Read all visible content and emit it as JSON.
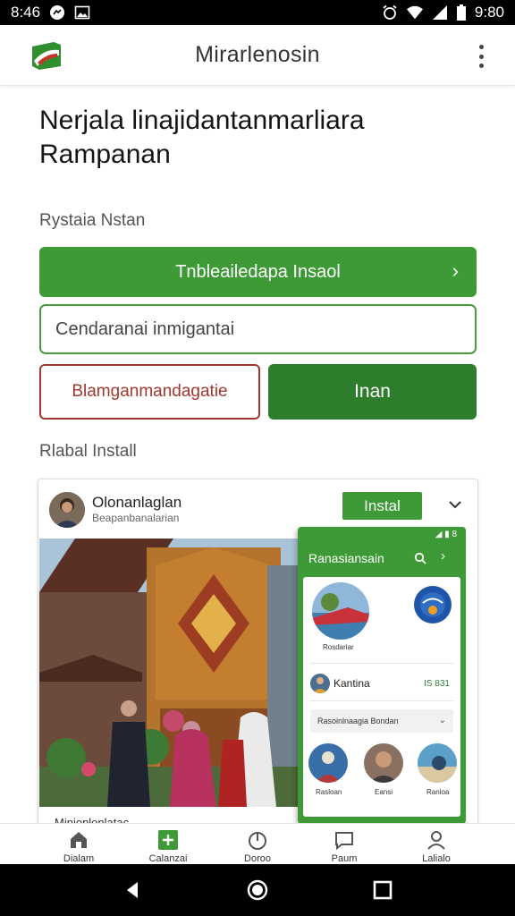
{
  "status_bar": {
    "time_left": "8:46",
    "time_right": "9:80"
  },
  "app": {
    "title": "Mirarlenosin"
  },
  "headline": {
    "line1": "Nerjala linajidantanmarliara",
    "line2": "Rampanan"
  },
  "section_install": {
    "label": "Rystaia Nstan",
    "primary_button": "Tnbleailedapa Insaol",
    "input_placeholder": "Cendaranai inmigantai",
    "outline_button": "Blamganmandagatie",
    "solid_button": "Inan"
  },
  "section_mabal": {
    "label": "Rlabal Install"
  },
  "card": {
    "author": "Olonanlaglan",
    "subtitle": "Beapanbanalarian",
    "install_label": "Instal",
    "caption": "Minionlonlatac"
  },
  "phone_preview": {
    "status": "◢ ▮ 8",
    "title": "Ranasiansain",
    "circle1_caption": "Rosdariar",
    "row_name": "Kantina",
    "row_value": "IS 831",
    "select_label": "Rasoinlnaagia Bondan",
    "bottom_captions": [
      "Rasloan",
      "Eansi",
      "Ranloa"
    ]
  },
  "bottom_nav": {
    "items": [
      {
        "label": "Dialam",
        "icon": "home-icon"
      },
      {
        "label": "Calanzai",
        "icon": "plus-icon"
      },
      {
        "label": "Doroo",
        "icon": "power-icon"
      },
      {
        "label": "Paum",
        "icon": "chat-icon"
      },
      {
        "label": "Lalialo",
        "icon": "person-icon"
      }
    ]
  },
  "colors": {
    "accent_green": "#3e9a36",
    "dark_green": "#2e7d2d",
    "outline_red": "#a1372f"
  }
}
